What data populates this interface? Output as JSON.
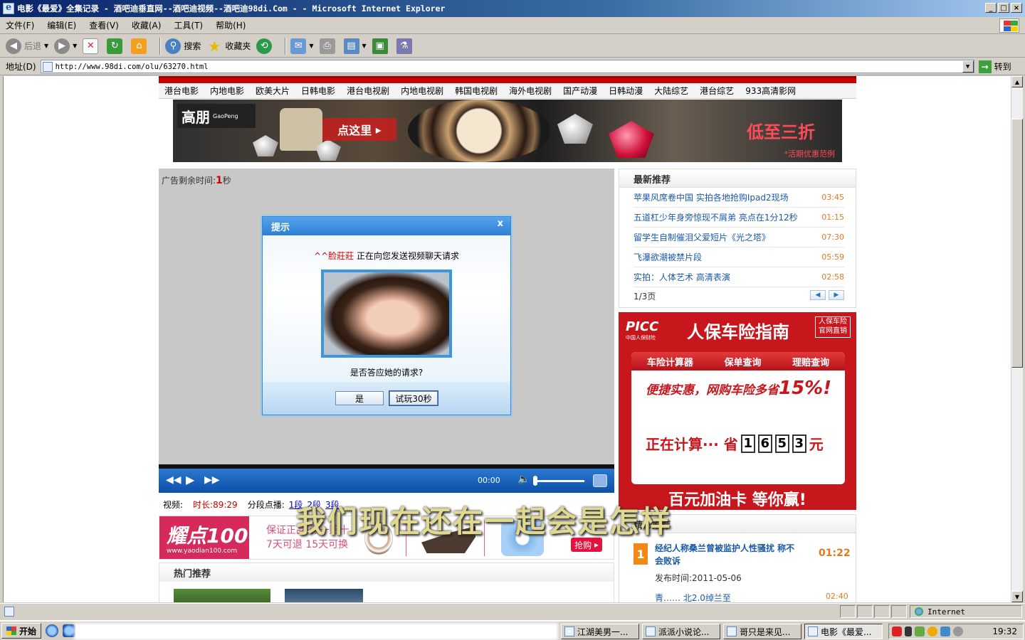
{
  "window": {
    "title": "电影《最爱》全集记录 - 酒吧迪垂直网--酒吧迪视频--酒吧迪98di.Com - - Microsoft Internet Explorer",
    "min": "_",
    "max": "□",
    "close": "×"
  },
  "menubar": [
    "文件(F)",
    "编辑(E)",
    "查看(V)",
    "收藏(A)",
    "工具(T)",
    "帮助(H)"
  ],
  "toolbar": {
    "back": "后退",
    "search": "搜索",
    "favorites": "收藏夹"
  },
  "address": {
    "label": "地址(D)",
    "url": "http://www.98di.com/olu/63270.html",
    "go": "转到"
  },
  "nav": [
    "港台电影",
    "内地电影",
    "欧美大片",
    "日韩电影",
    "港台电视剧",
    "内地电视剧",
    "韩国电视剧",
    "海外电视剧",
    "国产动漫",
    "日韩动漫",
    "大陆综艺",
    "港台综艺",
    "933高清影网"
  ],
  "banner_gaopeng": {
    "logo": "高朋",
    "logo_sub": "GaoPeng",
    "click": "点这里",
    "price": "低至三折",
    "note": "*活期优惠范例"
  },
  "player": {
    "ad_label": "广告剩余时间:",
    "ad_seconds": "1",
    "ad_unit": "秒",
    "time": "00:00"
  },
  "dialog": {
    "title": "提示",
    "close": "x",
    "nick": "^^脸莊莊",
    "message": "正在向您发送视频聊天请求",
    "question": "是否答应她的请求?",
    "yes": "是",
    "trial": "试玩30秒"
  },
  "video_info": {
    "label": "视频:",
    "duration": "时长:89:29",
    "segments_label": "分段点播:",
    "segments": [
      "1段",
      "2段",
      "3段"
    ]
  },
  "banner_yaodian": {
    "logo": "耀点100",
    "site": "www.yaodian100.com",
    "line1": "保证正品 假一赔十",
    "line2": "7天可退 15天可换",
    "buy": "抢购"
  },
  "hot": {
    "title": "热门推荐"
  },
  "latest": {
    "title": "最新推荐",
    "items": [
      {
        "text": "苹果风席卷中国 实拍各地抢购Ipad2现场",
        "time": "03:45"
      },
      {
        "text": "五道杠少年身旁惊现不屑弟 亮点在1分12秒",
        "time": "01:15"
      },
      {
        "text": "留学生自制催泪父爱短片《光之塔》",
        "time": "07:30"
      },
      {
        "text": "飞瀑欲潮被禁片段",
        "time": "05:59"
      },
      {
        "text": "实拍：人体艺术 高清表演",
        "time": "02:58"
      }
    ],
    "page": "1/3页"
  },
  "picc": {
    "logo": "PICC",
    "logo_sub": "中国人保财险",
    "title": "人保车险指南",
    "official": "人保车险官网直销",
    "tabs": [
      "车险计算器",
      "保单查询",
      "理赔查询"
    ],
    "slogan": "便捷实惠，网购车险多省",
    "slogan_pct": "15%!",
    "calc": "正在计算··· 省",
    "digits": [
      "1",
      "6",
      "5",
      "3"
    ],
    "unit": "元",
    "bottom": "百元加油卡 等你赢!"
  },
  "featured": {
    "title": "精彩推荐",
    "num": "1",
    "item_title": "经纪人称桑兰曾被监护人性骚扰 称不会败诉",
    "time": "01:22",
    "date": "发布时间:2011-05-06",
    "more": "青…… 北2.0绰兰至",
    "more_time": "02:40"
  },
  "subtitle": "我们现在还在一起会是怎样",
  "status": {
    "zone": "Internet"
  },
  "taskbar": {
    "start": "开始",
    "tasks": [
      "江湖美男一...",
      "派派小说论...",
      "哥只是来见...",
      "电影《最爱..."
    ],
    "clock": "19:32"
  },
  "colors": {
    "accent_red": "#c8161d",
    "player_blue": "#2a78d0",
    "link_blue": "#1a5aa8",
    "time_orange": "#e07a20"
  }
}
